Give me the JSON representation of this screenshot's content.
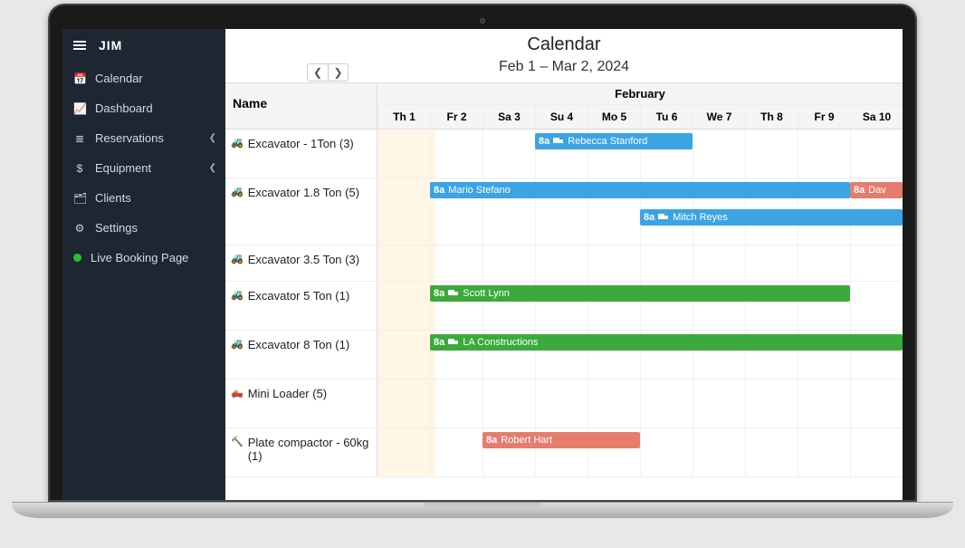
{
  "brand": "JIM",
  "sidebar": {
    "items": [
      {
        "icon": "calendar",
        "label": "Calendar"
      },
      {
        "icon": "chart",
        "label": "Dashboard"
      },
      {
        "icon": "list",
        "label": "Reservations",
        "expand": true
      },
      {
        "icon": "dollar",
        "label": "Equipment",
        "expand": true
      },
      {
        "icon": "card",
        "label": "Clients"
      },
      {
        "icon": "gear",
        "label": "Settings"
      },
      {
        "icon": "live",
        "label": "Live Booking Page"
      }
    ]
  },
  "header": {
    "title": "Calendar",
    "range": "Feb 1 – Mar 2, 2024",
    "month": "February",
    "name_col": "Name",
    "days": [
      "Th 1",
      "Fr 2",
      "Sa 3",
      "Su 4",
      "Mo 5",
      "Tu 6",
      "We 7",
      "Th 8",
      "Fr 9",
      "Sa 10"
    ]
  },
  "resources": [
    {
      "name": "Excavator - 1Ton (3)",
      "icon": "🚜",
      "height": "med",
      "events": [
        {
          "time": "8a",
          "label": "Rebecca Stanford",
          "color": "blue",
          "start": 3,
          "span": 3,
          "truck": true
        }
      ]
    },
    {
      "name": "Excavator 1.8 Ton (5)",
      "icon": "🚜",
      "height": "tall",
      "events": [
        {
          "time": "8a",
          "label": "Mario Stefano",
          "color": "blue",
          "start": 1,
          "span": 8,
          "truck": false
        },
        {
          "time": "8a",
          "label": "Dav",
          "color": "red",
          "start": 9,
          "span": 1,
          "truck": false
        },
        {
          "time": "8a",
          "label": "Mitch Reyes",
          "color": "blue",
          "start": 5,
          "span": 5,
          "row": 2,
          "truck": true
        }
      ]
    },
    {
      "name": "Excavator 3.5 Ton (3)",
      "icon": "🚜",
      "height": "",
      "events": []
    },
    {
      "name": "Excavator 5 Ton (1)",
      "icon": "🚜",
      "height": "med",
      "events": [
        {
          "time": "8a",
          "label": "Scott Lynn",
          "color": "green",
          "start": 1,
          "span": 8,
          "truck": true
        }
      ]
    },
    {
      "name": "Excavator 8 Ton (1)",
      "icon": "🚜",
      "height": "med",
      "events": [
        {
          "time": "8a",
          "label": "LA Constructions",
          "color": "green",
          "start": 1,
          "span": 9,
          "truck": true
        }
      ]
    },
    {
      "name": "Mini Loader (5)",
      "icon": "🛻",
      "height": "med",
      "events": []
    },
    {
      "name": "Plate compactor - 60kg (1)",
      "icon": "🔨",
      "height": "med",
      "events": [
        {
          "time": "8a",
          "label": "Robert Hart",
          "color": "red",
          "start": 2,
          "span": 3,
          "truck": false
        }
      ]
    }
  ],
  "icons": {
    "calendar": "📅",
    "chart": "📈",
    "list": "≣",
    "dollar": "$",
    "card": "🗂",
    "gear": "⚙"
  }
}
